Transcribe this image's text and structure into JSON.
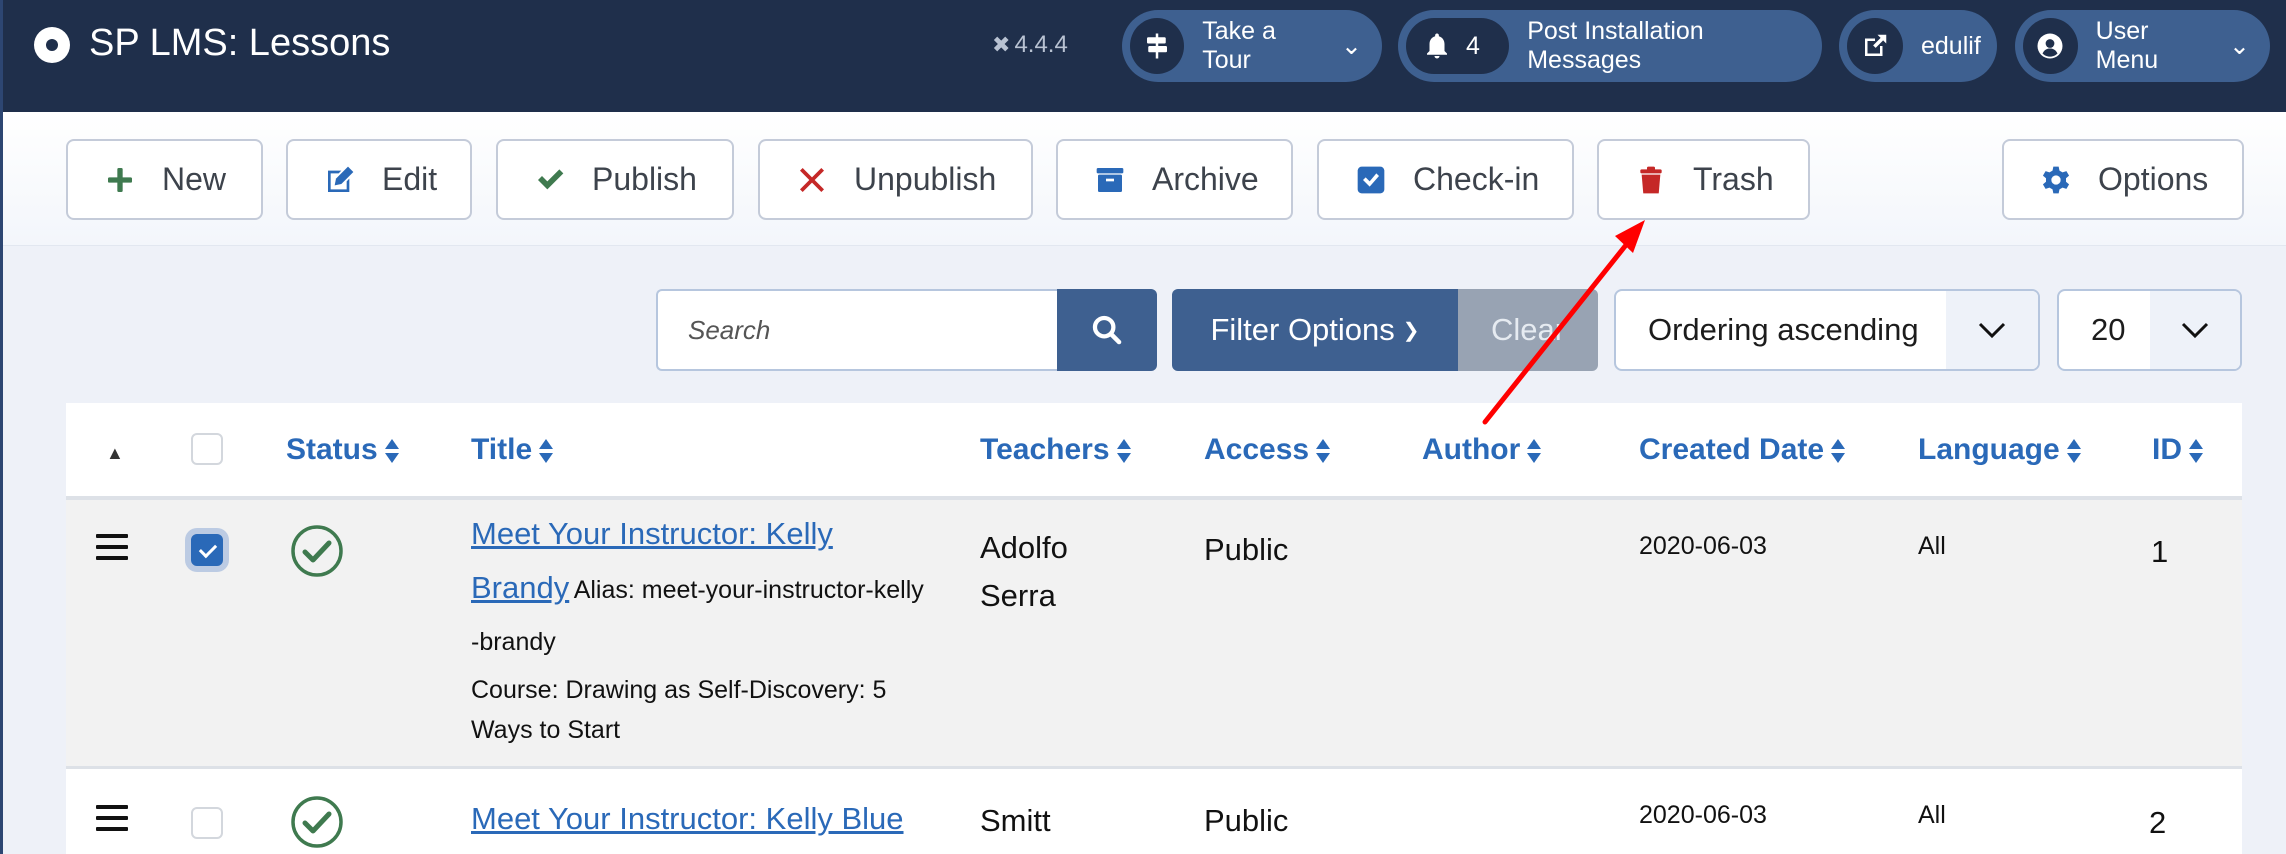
{
  "header": {
    "title": "SP LMS: Lessons",
    "version": "4.4.4",
    "version_icon": "joomla-icon",
    "tour_label": "Take a Tour",
    "messages_count": "4",
    "messages_label": "Post Installation Messages",
    "site_label": "edulif",
    "user_label": "User Menu"
  },
  "toolbar": {
    "new": "New",
    "edit": "Edit",
    "publish": "Publish",
    "unpublish": "Unpublish",
    "archive": "Archive",
    "checkin": "Check-in",
    "trash": "Trash",
    "options": "Options"
  },
  "filters": {
    "search_placeholder": "Search",
    "search_value": "",
    "filter_options_label": "Filter Options",
    "clear_label": "Clear",
    "ordering_selected": "Ordering ascending",
    "limit_selected": "20"
  },
  "table": {
    "columns": [
      "Status",
      "Title",
      "Teachers",
      "Access",
      "Author",
      "Created Date",
      "Language",
      "ID"
    ],
    "rows": [
      {
        "checked": true,
        "status": "published",
        "title": "Meet Your Instructor: Kelly Brandy",
        "alias_label": "Alias: meet-your-instructor-kelly-brandy",
        "course_label": "Course: Drawing as Self-Discovery: 5 Ways to Start",
        "teachers": "Adolfo Serra",
        "access": "Public",
        "author": "",
        "created": "2020-06-03",
        "language": "All",
        "id": "1"
      },
      {
        "checked": false,
        "status": "published",
        "title": "Meet Your Instructor: Kelly Blue",
        "teachers": "Smitt",
        "access": "Public",
        "author": "",
        "created": "2020-06-03",
        "language": "All",
        "id": "2"
      }
    ]
  },
  "colors": {
    "header_bg": "#1f2f4b",
    "pill_bg": "#3e6090",
    "link": "#2a69b8",
    "publish_green": "#3f7a4f",
    "unpublish_red": "#c52827",
    "annotation_arrow": "#ff0000"
  }
}
